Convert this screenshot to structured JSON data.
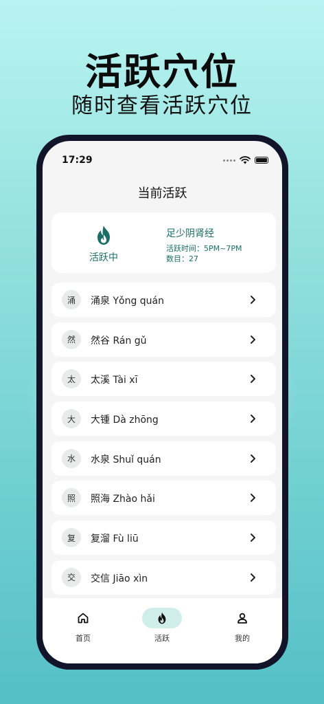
{
  "promo": {
    "title": "活跃穴位",
    "subtitle": "随时查看活跃穴位"
  },
  "status_bar": {
    "time": "17:29"
  },
  "nav": {
    "title": "当前活跃"
  },
  "active_meridian": {
    "status": "活跃中",
    "name": "足少阴肾经",
    "active_time": "活跃时间：5PM~7PM",
    "count": "数目：27"
  },
  "points": [
    {
      "badge": "涌",
      "label": "涌泉 Yǒng quán"
    },
    {
      "badge": "然",
      "label": "然谷 Rán gǔ"
    },
    {
      "badge": "太",
      "label": "太溪 Tài xī"
    },
    {
      "badge": "大",
      "label": "大锺 Dà zhōng"
    },
    {
      "badge": "水",
      "label": "水泉 Shuǐ quán"
    },
    {
      "badge": "照",
      "label": "照海 Zhào hǎi"
    },
    {
      "badge": "复",
      "label": "复溜 Fù liū"
    },
    {
      "badge": "交",
      "label": "交信 Jiāo xìn"
    }
  ],
  "tabs": [
    {
      "label": "首页",
      "icon": "home-icon"
    },
    {
      "label": "活跃",
      "icon": "flame-icon"
    },
    {
      "label": "我的",
      "icon": "user-icon"
    }
  ],
  "colors": {
    "accent": "#1a6e67",
    "tab_active_bg": "#cfeee9"
  }
}
